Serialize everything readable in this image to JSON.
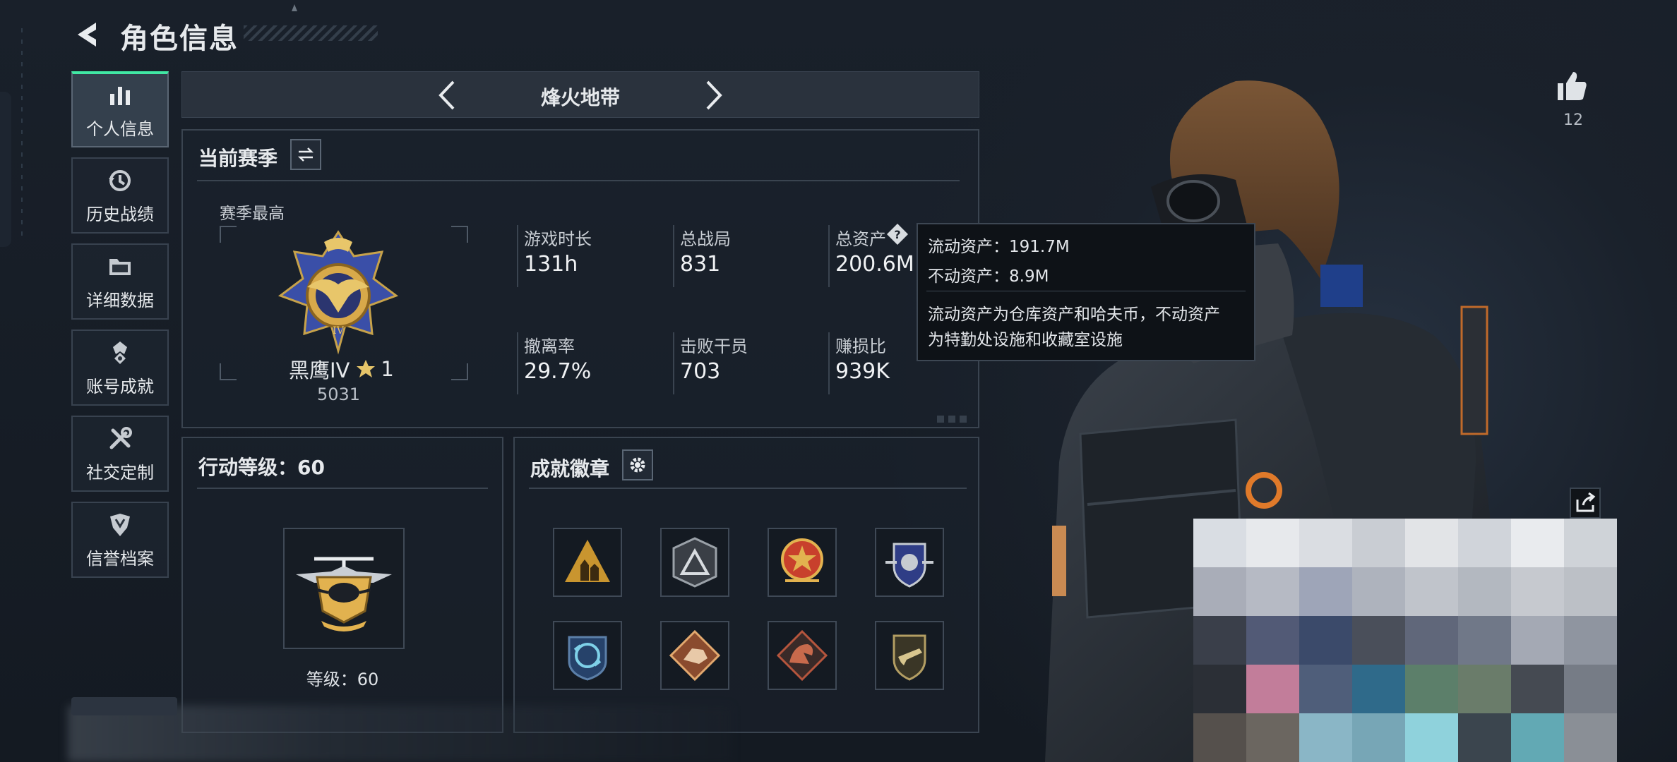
{
  "header": {
    "title": "角色信息"
  },
  "sidebar": {
    "items": [
      {
        "label": "个人信息",
        "icon": "bar-chart-icon",
        "active": true
      },
      {
        "label": "历史战绩",
        "icon": "history-icon",
        "active": false
      },
      {
        "label": "详细数据",
        "icon": "folder-icon",
        "active": false
      },
      {
        "label": "账号成就",
        "icon": "achievement-icon",
        "active": false
      },
      {
        "label": "社交定制",
        "icon": "tools-icon",
        "active": false
      },
      {
        "label": "信誉档案",
        "icon": "credit-shield-icon",
        "active": false
      }
    ]
  },
  "mode": {
    "title": "烽火地带"
  },
  "season": {
    "header": "当前赛季",
    "best_label": "赛季最高",
    "rank_name": "黑鹰IV",
    "rank_star_count": "1",
    "rank_score": "5031",
    "stats": [
      {
        "label": "游戏时长",
        "value": "131h"
      },
      {
        "label": "总战局",
        "value": "831"
      },
      {
        "label": "总资产",
        "value": "200.6M"
      },
      {
        "label": "撤离率",
        "value": "29.7%"
      },
      {
        "label": "击败干员",
        "value": "703"
      },
      {
        "label": "赚损比",
        "value": "939K"
      }
    ]
  },
  "tooltip": {
    "line1": "流动资产：191.7M",
    "line2": "不动资产：8.9M",
    "desc1": "流动资产为仓库资产和哈夫币，不动资产",
    "desc2": "为特勤处设施和收藏室设施"
  },
  "level": {
    "header": "行动等级：60",
    "caption": "等级：60"
  },
  "badges": {
    "header": "成就徽章",
    "items": [
      {
        "icon": "badge-soldiers-icon",
        "color": "#c9952f"
      },
      {
        "icon": "badge-triangle-icon",
        "color": "#9aa1a8"
      },
      {
        "icon": "badge-star-medal-icon",
        "color": "#c8402c"
      },
      {
        "icon": "badge-shield-wings-icon",
        "color": "#5a6fc4"
      },
      {
        "icon": "badge-globe-arrows-icon",
        "color": "#4aa0c8"
      },
      {
        "icon": "badge-hound-icon",
        "color": "#c98760"
      },
      {
        "icon": "badge-dragon-icon",
        "color": "#b5553d"
      },
      {
        "icon": "badge-rifle-icon",
        "color": "#b39e63"
      }
    ]
  },
  "social": {
    "likes": "12"
  },
  "colors": {
    "accent": "#41e8a4",
    "gold": "#d8a94a",
    "panel_border": "#3a4450"
  }
}
